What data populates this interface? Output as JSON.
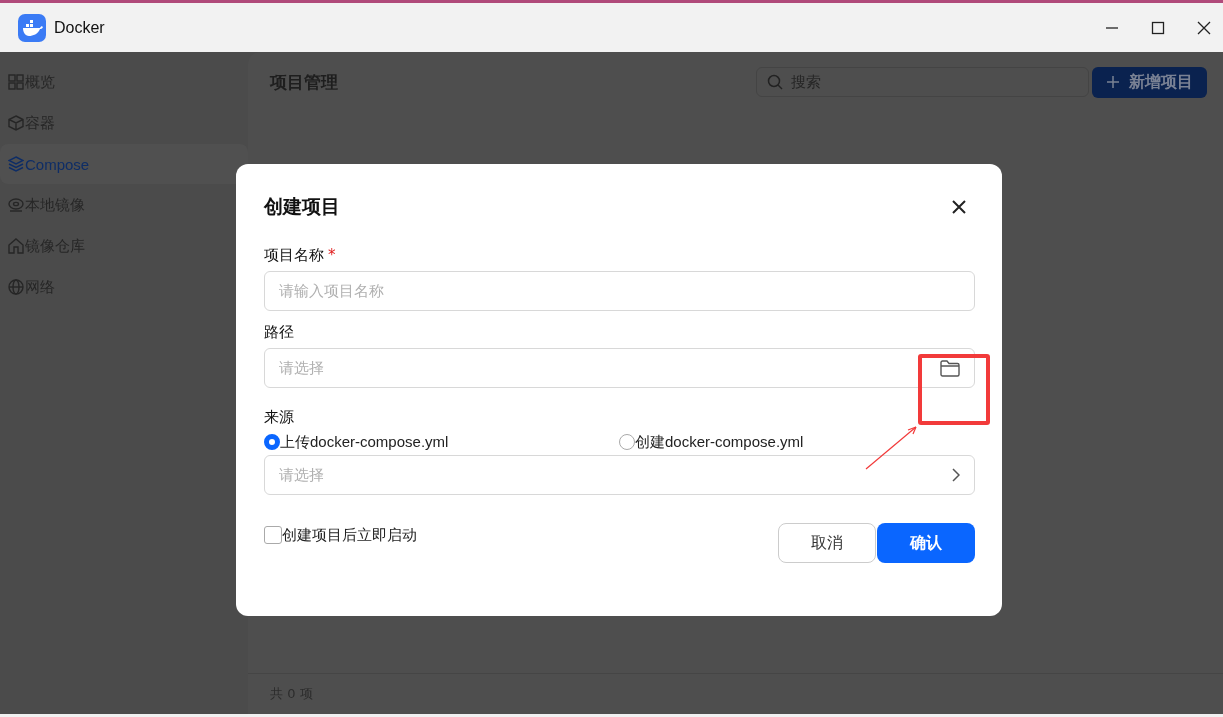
{
  "window": {
    "title": "Docker"
  },
  "sidebar": {
    "items": [
      {
        "label": "概览",
        "selected": false
      },
      {
        "label": "容器",
        "selected": false
      },
      {
        "label": "Compose",
        "selected": true
      },
      {
        "label": "本地镜像",
        "selected": false
      },
      {
        "label": "镜像仓库",
        "selected": false
      },
      {
        "label": "网络",
        "selected": false
      }
    ]
  },
  "page": {
    "title": "项目管理",
    "search": {
      "placeholder": "搜索"
    },
    "add_button": "新增项目",
    "footer": "共 0 项"
  },
  "dialog": {
    "title": "创建项目",
    "fields": [
      {
        "label": "项目名称",
        "required_mark": "*",
        "placeholder": "请输入项目名称",
        "kind": "text"
      },
      {
        "label": "路径",
        "placeholder": "请选择",
        "kind": "folder"
      }
    ],
    "source": {
      "label": "来源",
      "options": [
        {
          "label": "上传docker-compose.yml",
          "selected": true
        },
        {
          "label": "创建docker-compose.yml",
          "selected": false
        }
      ],
      "placeholder": "请选择"
    },
    "start_after": {
      "label": "创建项目后立即启动",
      "checked": false
    },
    "buttons": [
      {
        "label": "取消",
        "kind": "secondary"
      },
      {
        "label": "确认",
        "kind": "primary"
      }
    ]
  }
}
